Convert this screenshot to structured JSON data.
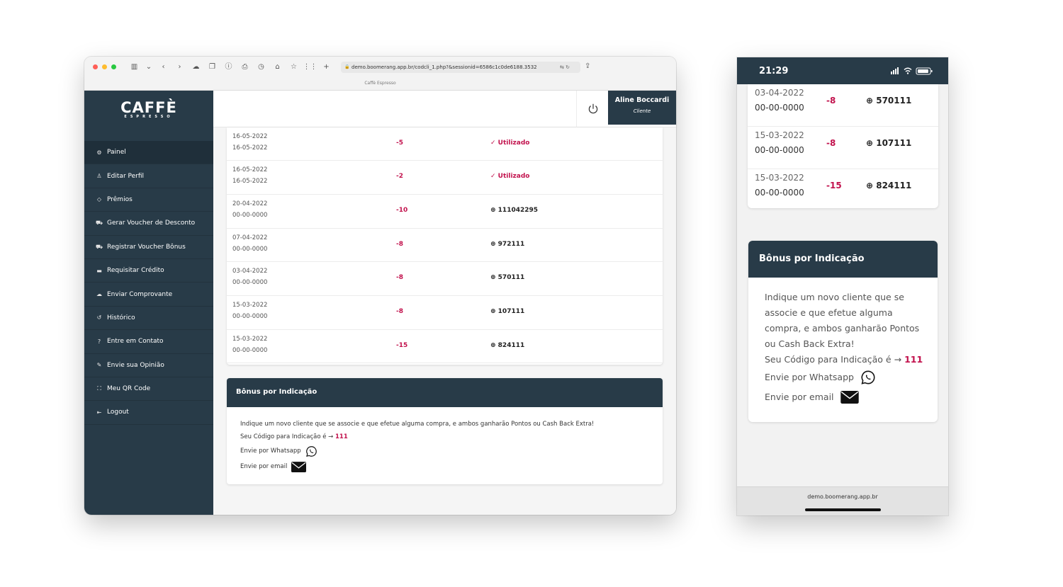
{
  "desktop": {
    "browser": {
      "url": "demo.boomerang.app.br/codcli_1.php?&sessionid=6586c1c0de6188.3532",
      "tab_title": "Caffè Espresso"
    },
    "logo": {
      "main": "CAFFÈ",
      "sub": "ESPRESSO"
    },
    "menu": [
      {
        "label": "Painel",
        "icon": "gear-icon",
        "glyph": "⚙"
      },
      {
        "label": "Editar Perfil",
        "icon": "user-icon",
        "glyph": "♙"
      },
      {
        "label": "Prêmios",
        "icon": "diamond-icon",
        "glyph": "◇"
      },
      {
        "label": "Gerar Voucher de Desconto",
        "icon": "cart-icon",
        "glyph": "⛟"
      },
      {
        "label": "Registrar Voucher Bônus",
        "icon": "cart-icon",
        "glyph": "⛟"
      },
      {
        "label": "Requisitar Crédito",
        "icon": "card-icon",
        "glyph": "▬"
      },
      {
        "label": "Enviar Comprovante",
        "icon": "upload-cloud-icon",
        "glyph": "☁"
      },
      {
        "label": "Histórico",
        "icon": "history-icon",
        "glyph": "↺"
      },
      {
        "label": "Entre em Contato",
        "icon": "help-icon",
        "glyph": "?"
      },
      {
        "label": "Envie sua Opinião",
        "icon": "chat-icon",
        "glyph": "✎"
      },
      {
        "label": "Meu QR Code",
        "icon": "qr-icon",
        "glyph": "⛶"
      },
      {
        "label": "Logout",
        "icon": "logout-icon",
        "glyph": "⇤"
      }
    ],
    "user": {
      "name": "Aline Boccardi",
      "role": "Cliente"
    },
    "rows": [
      {
        "date1": "16-05-2022",
        "date2": "16-05-2022",
        "points": "-5",
        "status": "✓ Utilizado",
        "used": true
      },
      {
        "date1": "16-05-2022",
        "date2": "16-05-2022",
        "points": "-2",
        "status": "✓ Utilizado",
        "used": true
      },
      {
        "date1": "20-04-2022",
        "date2": "00-00-0000",
        "points": "-10",
        "status": "⊕ 111042295",
        "used": false
      },
      {
        "date1": "07-04-2022",
        "date2": "00-00-0000",
        "points": "-8",
        "status": "⊕ 972111",
        "used": false
      },
      {
        "date1": "03-04-2022",
        "date2": "00-00-0000",
        "points": "-8",
        "status": "⊕ 570111",
        "used": false
      },
      {
        "date1": "15-03-2022",
        "date2": "00-00-0000",
        "points": "-8",
        "status": "⊕ 107111",
        "used": false
      },
      {
        "date1": "15-03-2022",
        "date2": "00-00-0000",
        "points": "-15",
        "status": "⊕ 824111",
        "used": false
      }
    ]
  },
  "bonus": {
    "title": "Bônus por Indicação",
    "text_full": "Indique um novo cliente que se associe e que efetue alguma compra, e ambos ganharão Pontos ou Cash Back Extra!",
    "code_label": "Seu Código para Indicação é →",
    "code": "111",
    "whatsapp": "Envie por Whatsapp",
    "email": "Envie por email"
  },
  "phone": {
    "time": "21:29",
    "url": "demo.boomerang.app.br",
    "rows": [
      {
        "date1": "03-04-2022",
        "date2": "00-00-0000",
        "points": "-8",
        "status": "⊕ 570111"
      },
      {
        "date1": "15-03-2022",
        "date2": "00-00-0000",
        "points": "-8",
        "status": "⊕ 107111"
      },
      {
        "date1": "15-03-2022",
        "date2": "00-00-0000",
        "points": "-15",
        "status": "⊕ 824111"
      }
    ]
  },
  "colors": {
    "sidebar": "#283b48",
    "accent": "#c2124d",
    "background": "#f5f5f5"
  }
}
